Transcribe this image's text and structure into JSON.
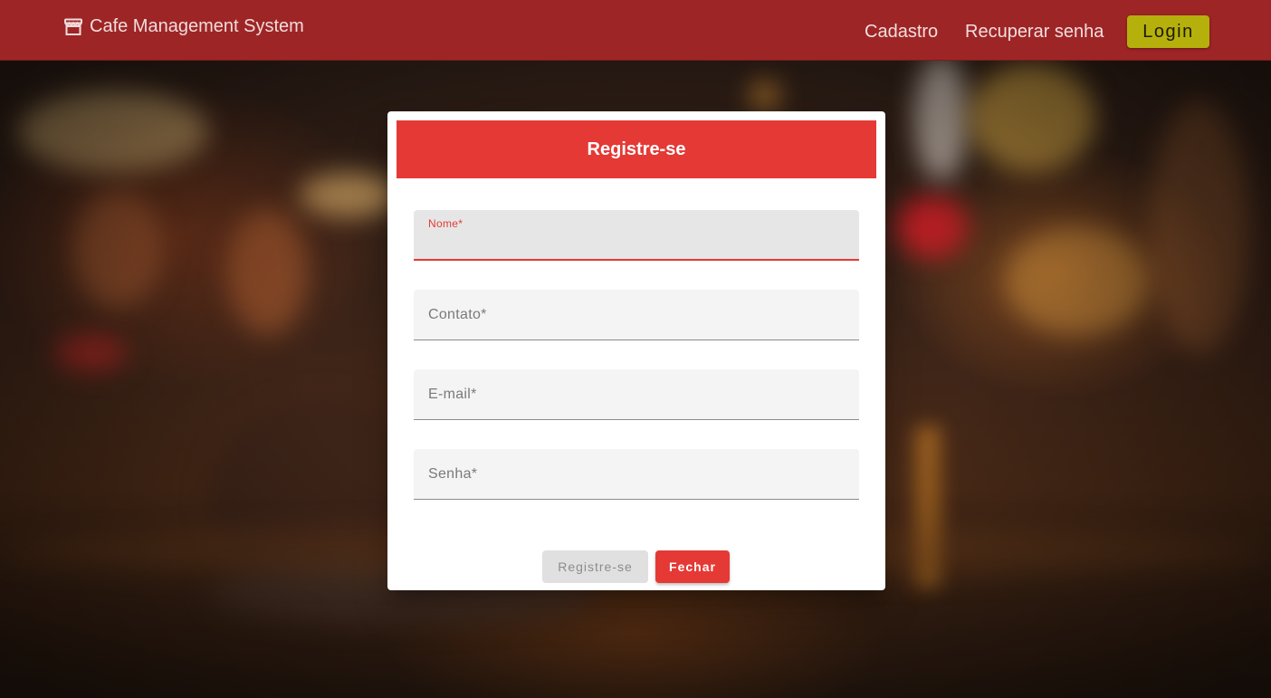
{
  "app": {
    "title": "Cafe Management System",
    "brand_icon": "store-icon"
  },
  "nav": {
    "signup": "Cadastro",
    "recover_password": "Recuperar senha",
    "login": "Login"
  },
  "dialog": {
    "title": "Registre-se",
    "fields": [
      {
        "label": "Nome*",
        "value": "",
        "focused": true
      },
      {
        "label": "Contato*",
        "value": ""
      },
      {
        "label": "E-mail*",
        "value": ""
      },
      {
        "label": "Senha*",
        "value": ""
      }
    ],
    "register_button": "Registre-se",
    "close_button": "Fechar"
  },
  "colors": {
    "navbar": "#9e2526",
    "primary": "#e53935",
    "login_button": "#b5b00c",
    "disabled_button": "#e0e0e0"
  }
}
